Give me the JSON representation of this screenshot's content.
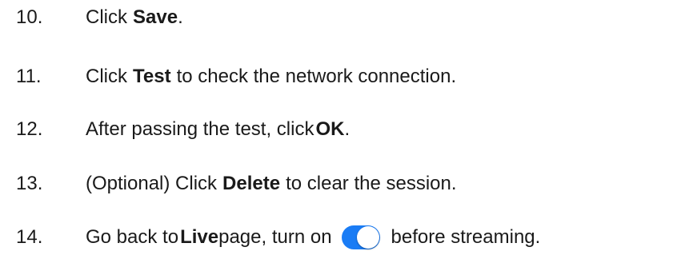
{
  "steps": [
    {
      "number": "10.",
      "pre": "Click ",
      "bold": "Save",
      "post": "."
    },
    {
      "number": "11.",
      "pre": "Click ",
      "bold": "Test",
      "post": " to check the network connection."
    },
    {
      "number": "12.",
      "pre": "After passing the test, click",
      "bold": "OK",
      "post": "."
    },
    {
      "number": "13.",
      "pre": "(Optional) Click ",
      "bold": "Delete",
      "post": " to clear the session."
    },
    {
      "number": "14.",
      "pre": "Go back to",
      "bold": "Live",
      "post_a": " page, turn on",
      "post_b": "before streaming."
    }
  ],
  "toggle": {
    "icon": "toggle-switch-on-icon",
    "state": "on",
    "color": "#1a7cf5"
  }
}
